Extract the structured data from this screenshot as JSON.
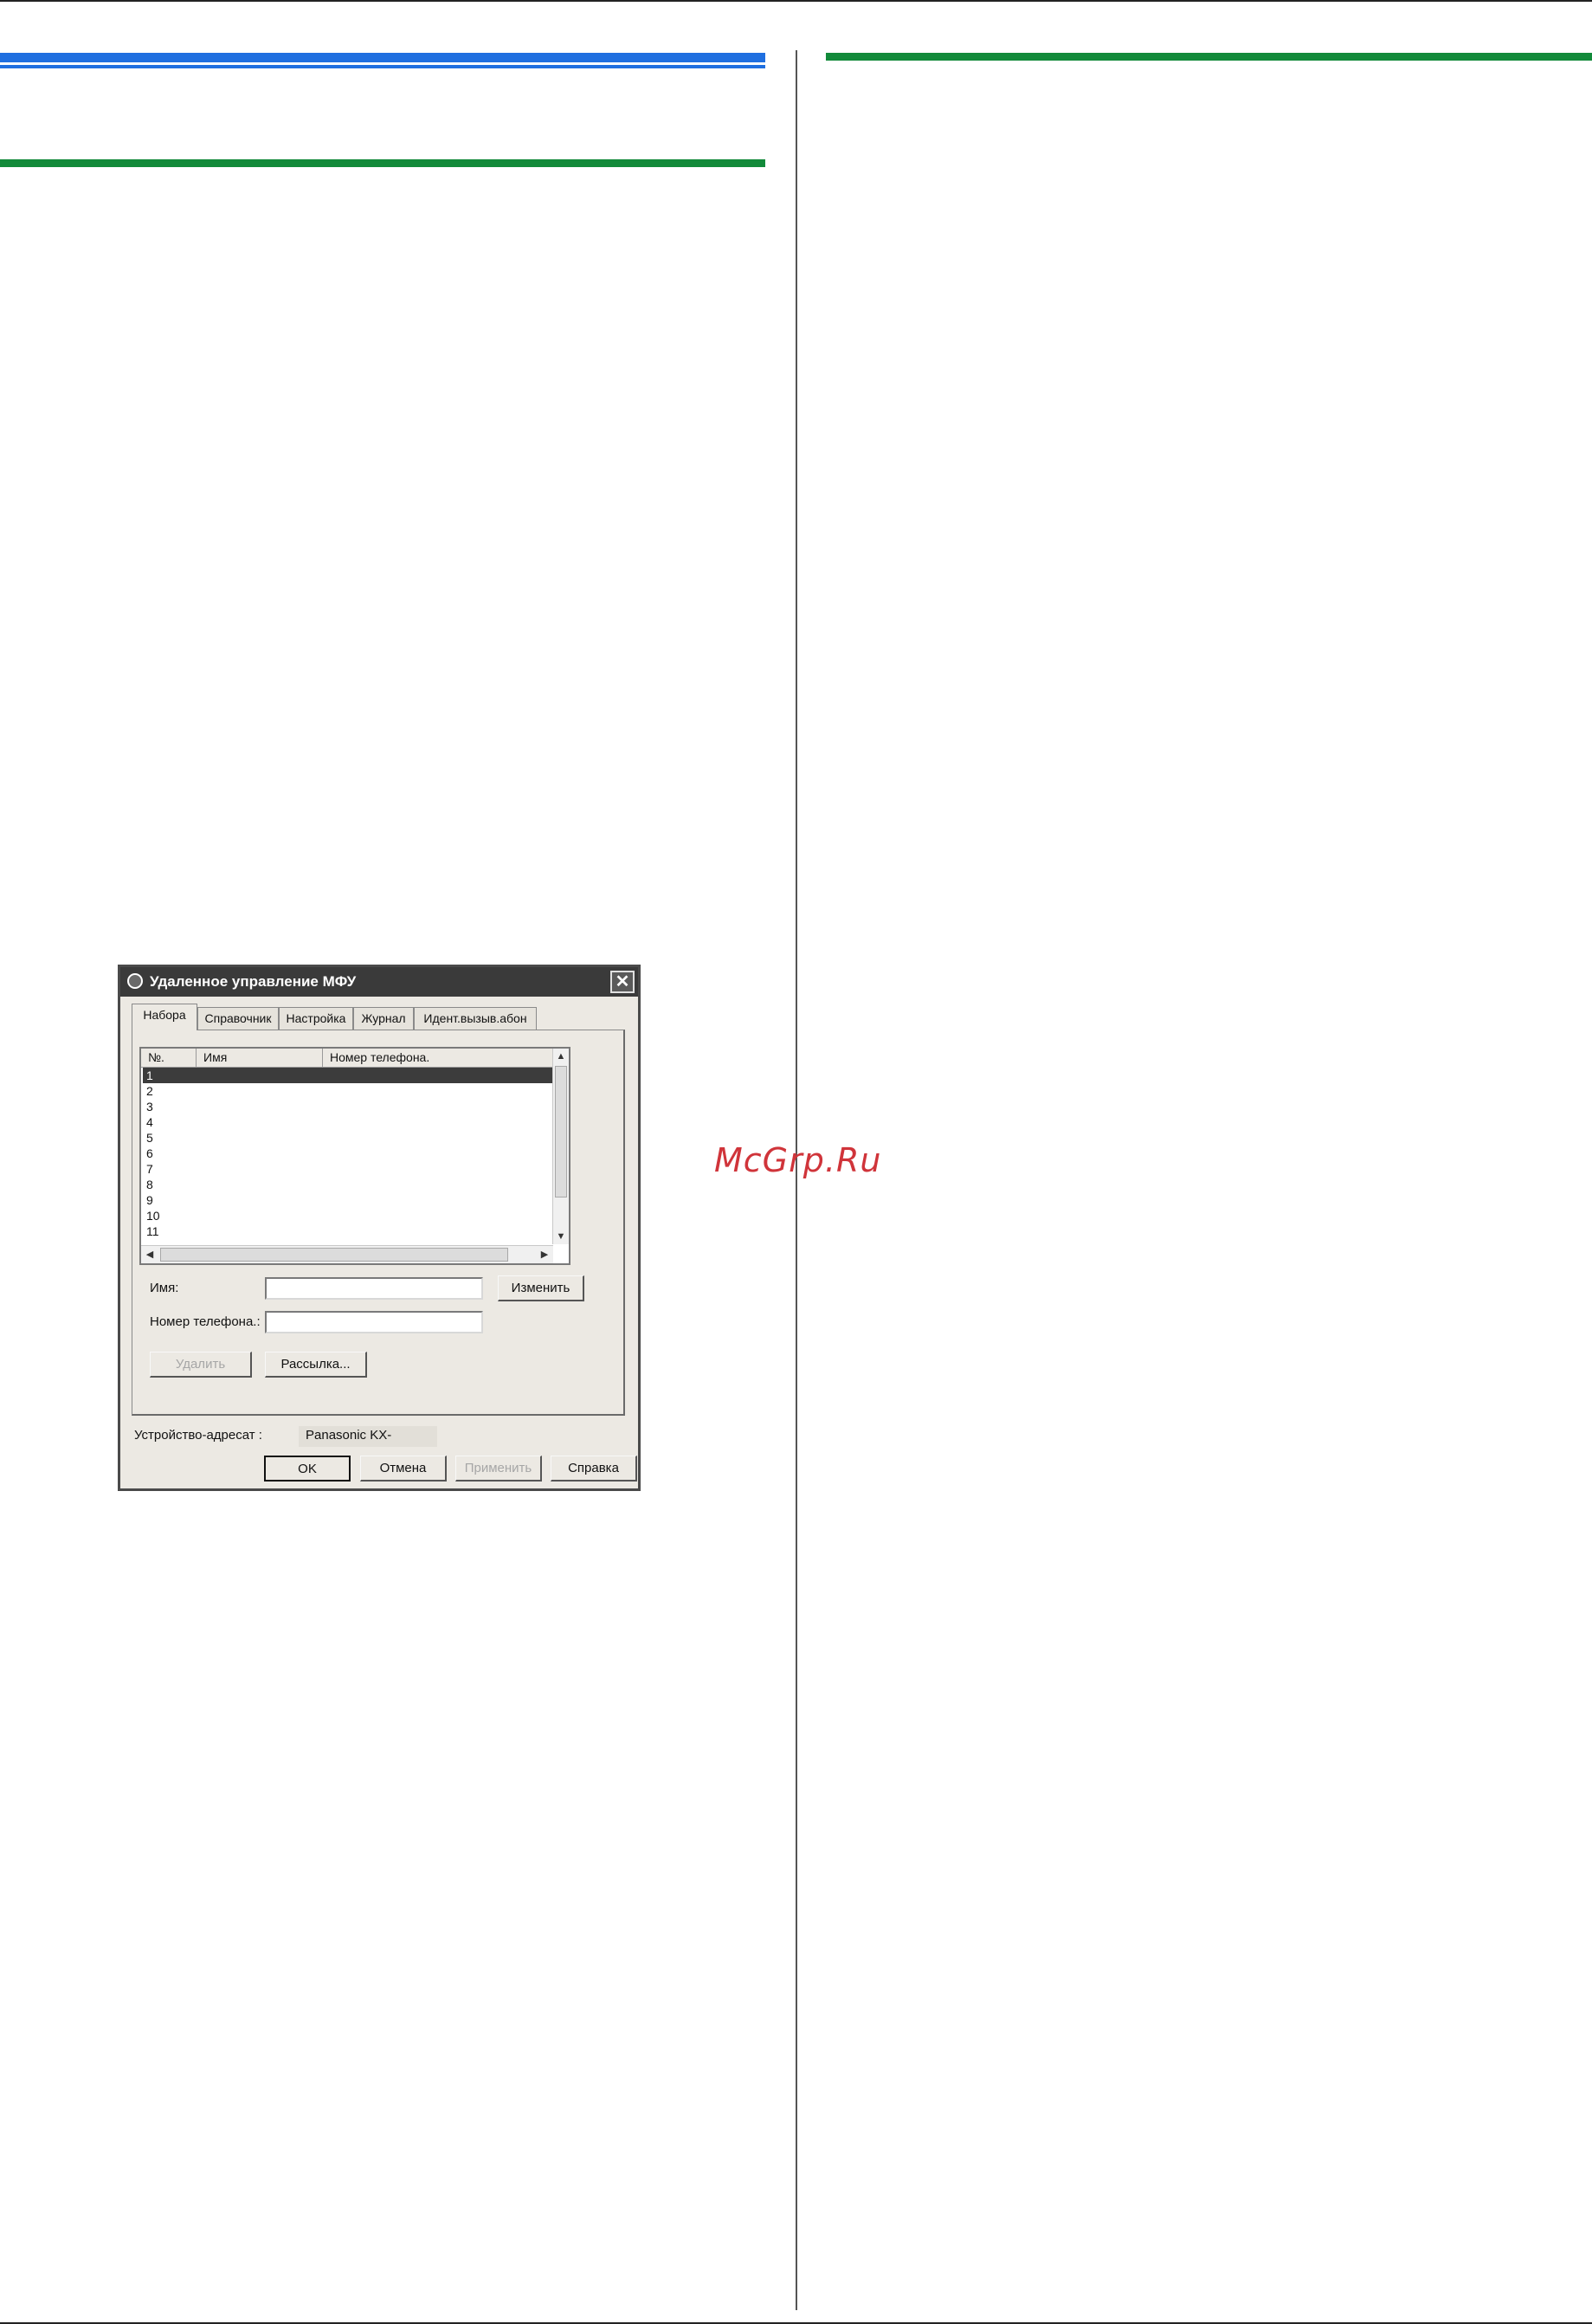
{
  "watermark": "McGrp.Ru",
  "dialog": {
    "title": "Удаленное управление МФУ",
    "close_symbol": "✕",
    "tabs": [
      {
        "label": "Набора",
        "active": true
      },
      {
        "label": "Справочник",
        "active": false
      },
      {
        "label": "Настройка",
        "active": false
      },
      {
        "label": "Журнал",
        "active": false
      },
      {
        "label": "Идент.вызыв.абон",
        "active": false
      }
    ],
    "list": {
      "columns": [
        "№.",
        "Имя",
        "Номер телефона."
      ],
      "rows": [
        "1",
        "2",
        "3",
        "4",
        "5",
        "6",
        "7",
        "8",
        "9",
        "10",
        "11"
      ],
      "selected_row": "1"
    },
    "fields": {
      "name_label": "Имя:",
      "name_value": "",
      "phone_label": "Номер телефона.:",
      "phone_value": ""
    },
    "buttons": {
      "change": "Изменить",
      "delete": "Удалить",
      "broadcast": "Рассылка...",
      "ok": "OK",
      "cancel": "Отмена",
      "apply": "Применить",
      "help": "Справка"
    },
    "target_device_label": "Устройство-адресат :",
    "target_device_value": "Panasonic KX-",
    "icons": {
      "app": "app-icon",
      "close": "close-icon",
      "scroll_up": "▲",
      "scroll_down": "▼",
      "scroll_left": "◀",
      "scroll_right": "▶"
    },
    "colors": {
      "titlebar": "#3a3a3a",
      "selection": "#3c3c3c",
      "face": "#ece9e3"
    }
  },
  "page_colors": {
    "blue_bar": "#1f6fe0",
    "green_bar": "#128a3a",
    "watermark": "#d0343a"
  }
}
